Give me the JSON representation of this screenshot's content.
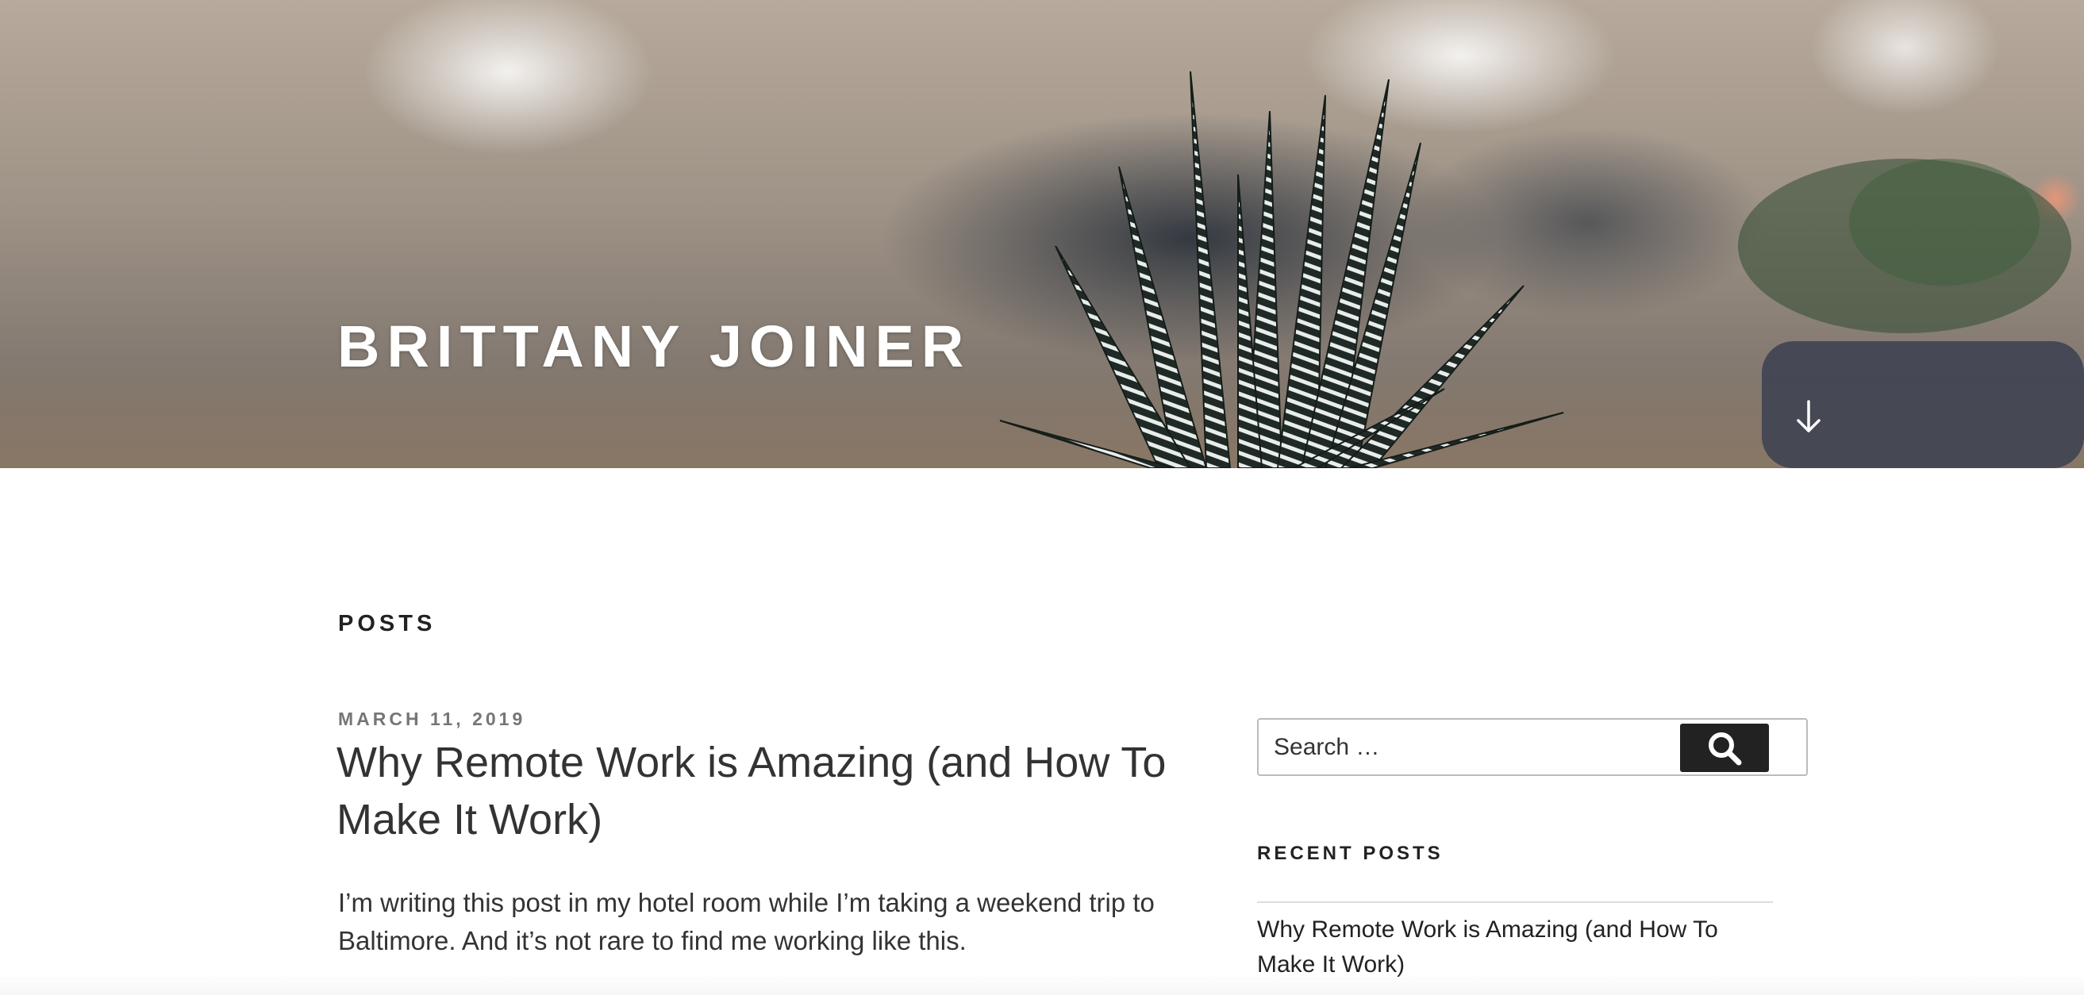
{
  "header": {
    "site_title": "BRITTANY JOINER",
    "scroll_icon": "arrow-down-icon"
  },
  "main": {
    "section_heading": "POSTS",
    "post": {
      "date": "MARCH 11, 2019",
      "title": "Why Remote Work is Amazing (and How To Make It Work)",
      "excerpt": "I’m writing this post in my hotel room while I’m taking a weekend trip to Baltimore. And it’s not rare to find me working like this."
    }
  },
  "sidebar": {
    "search": {
      "placeholder": "Search …",
      "button_icon": "search-icon"
    },
    "recent_posts": {
      "title": "RECENT POSTS",
      "items": [
        {
          "label": "Why Remote Work is Amazing (and How To Make It Work)"
        }
      ]
    }
  },
  "colors": {
    "text_dark": "#222222",
    "text_body": "#333333",
    "meta_gray": "#767676",
    "button_bg": "#222222",
    "border": "#bbbbbb"
  }
}
